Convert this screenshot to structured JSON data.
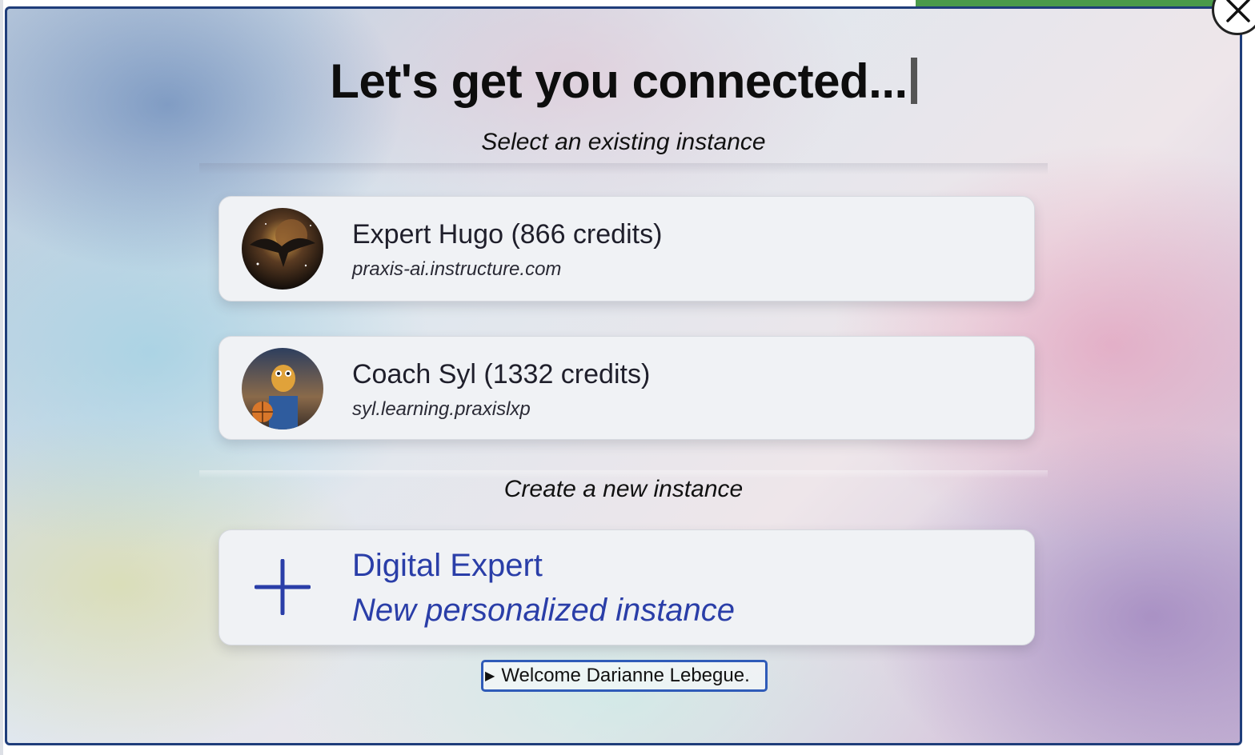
{
  "dialog": {
    "title": "Let's get you connected...",
    "existing_label": "Select an existing instance",
    "create_label": "Create a new instance",
    "instances": [
      {
        "name": "Expert Hugo (866 credits)",
        "domain": "praxis-ai.instructure.com",
        "avatar_icon": "eagle-avatar-icon"
      },
      {
        "name": "Coach Syl (1332 credits)",
        "domain": "syl.learning.praxislxp",
        "avatar_icon": "coach-avatar-icon"
      }
    ],
    "new_instance": {
      "title": "Digital Expert",
      "subtitle": "New personalized instance",
      "icon": "plus-icon",
      "accent_color": "#2a3ea8"
    },
    "welcome": {
      "text": "Welcome Darianne Lebegue."
    },
    "close_icon": "close-icon"
  },
  "colors": {
    "border": "#1f3d7a",
    "card_bg": "#f0f2f5",
    "accent": "#2a3ea8"
  }
}
